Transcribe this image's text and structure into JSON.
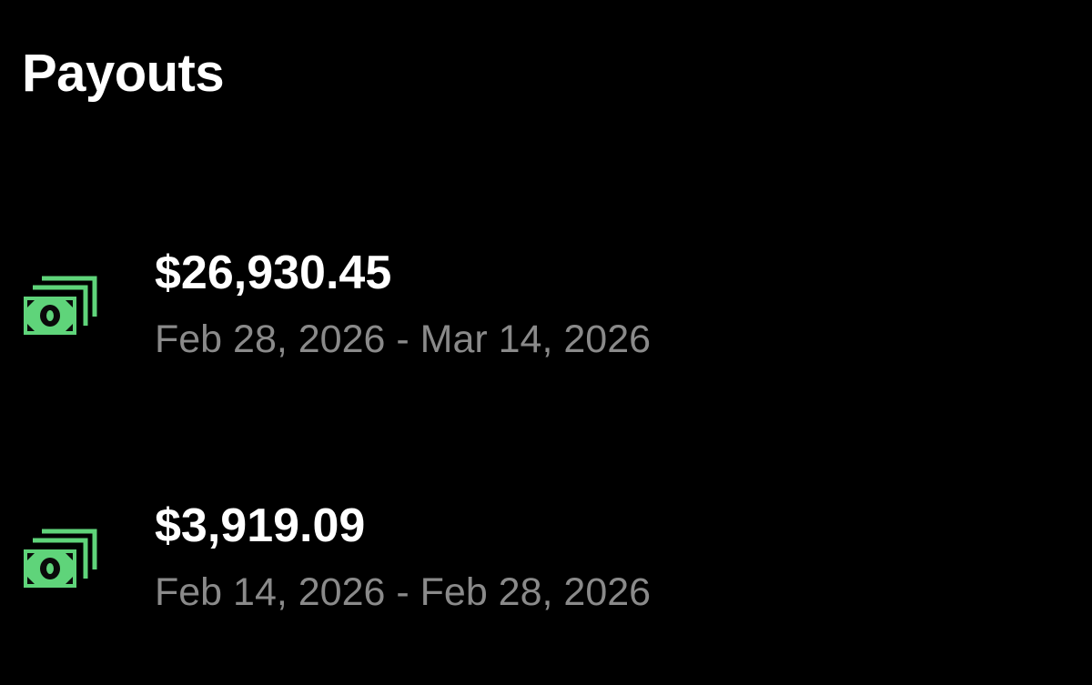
{
  "header": {
    "title": "Payouts"
  },
  "colors": {
    "background": "#000000",
    "text_primary": "#ffffff",
    "text_secondary": "#8a8a8a",
    "icon_accent": "#5fd47a"
  },
  "payouts": [
    {
      "icon": "cash-stack-icon",
      "amount": "$26,930.45",
      "date_range": "Feb 28, 2026 - Mar 14, 2026"
    },
    {
      "icon": "cash-stack-icon",
      "amount": "$3,919.09",
      "date_range": "Feb 14, 2026 - Feb 28, 2026"
    }
  ]
}
